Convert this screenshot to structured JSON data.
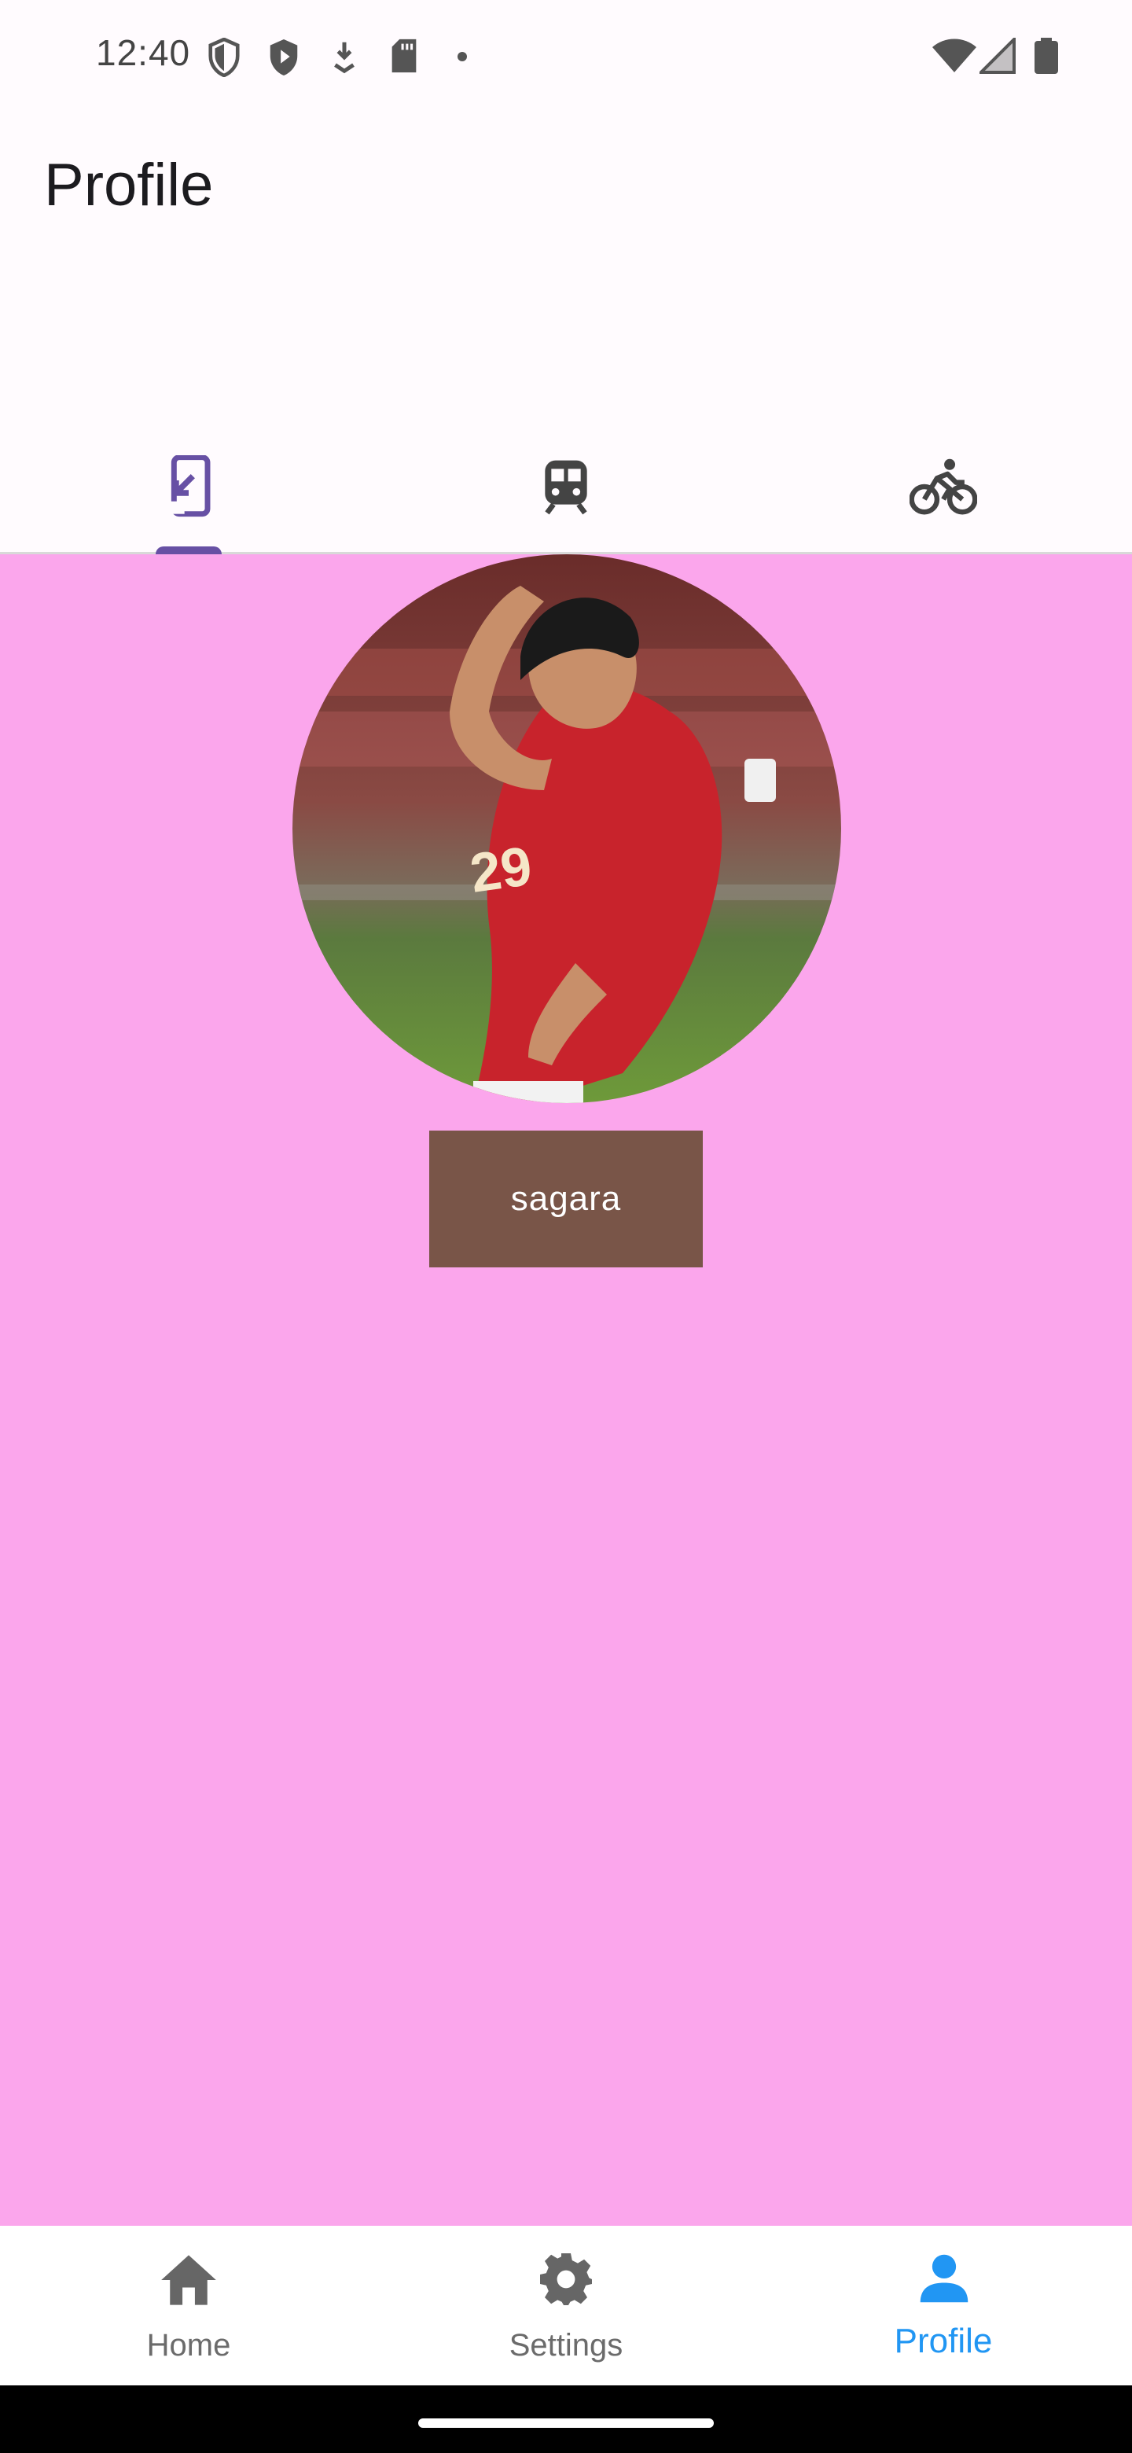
{
  "status_bar": {
    "time": "12:40",
    "left_icons": [
      "shield-icon",
      "play-protect-icon",
      "download-icon",
      "sd-card-icon",
      "dot-icon"
    ],
    "right_icons": [
      "wifi-icon",
      "cell-signal-icon",
      "battery-icon"
    ]
  },
  "app_bar": {
    "title": "Profile"
  },
  "tabs": [
    {
      "icon": "phone-forward-icon",
      "selected": true
    },
    {
      "icon": "train-icon",
      "selected": false
    },
    {
      "icon": "bike-icon",
      "selected": false
    }
  ],
  "profile": {
    "avatar_description": "player-photo",
    "name": "sagara"
  },
  "bottom_nav": {
    "items": [
      {
        "label": "Home",
        "icon": "home-icon"
      },
      {
        "label": "Settings",
        "icon": "settings-icon"
      },
      {
        "label": "Profile",
        "icon": "person-icon"
      }
    ],
    "active_index": 2
  },
  "colors": {
    "content_background": "#fba6ec",
    "tab_indicator": "#6750a4",
    "name_button": "#795548",
    "nav_active": "#2196f3",
    "nav_inactive": "#6b6b6b"
  }
}
